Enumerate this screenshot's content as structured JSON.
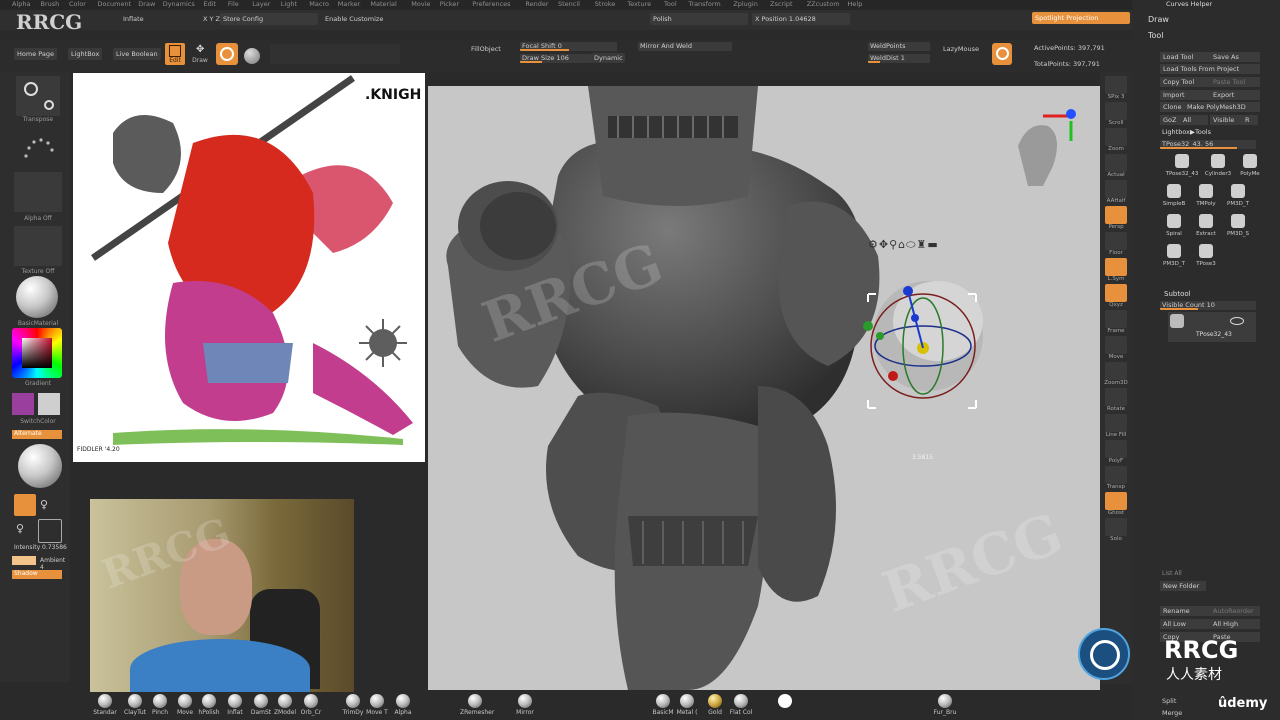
{
  "brand": {
    "watermark": "RRCG",
    "logo_text": "RRCG",
    "logo_sub": "人人素材",
    "udemy": "ûdemy"
  },
  "menu": [
    "Alpha",
    "Brush",
    "Color",
    "Document",
    "Draw",
    "Dynamics",
    "Edit",
    "File",
    "Layer",
    "Light",
    "Macro",
    "Marker",
    "Material",
    "Movie",
    "Picker",
    "Preferences",
    "Render",
    "Stencil",
    "Stroke",
    "Texture",
    "Tool",
    "Transform",
    "Zplugin",
    "Zscript",
    "ZZcustom",
    "Help"
  ],
  "top_row1": {
    "inflate": "Inflate",
    "xyz": "X Y Z",
    "store_config": "Store Config",
    "enable_customize": "Enable Customize",
    "polish": "Polish",
    "x_position": "X Position 1.04628",
    "spotlight": "Spotlight Projection"
  },
  "top_row2": {
    "home_page": "Home Page",
    "lightbox": "LightBox",
    "live_boolean": "Live Boolean",
    "edit": "Edit",
    "draw": "Draw",
    "fill_object": "FillObject",
    "focal_shift": "Focal Shift 0",
    "draw_size": "Draw Size 106",
    "dynamic": "Dynamic",
    "mirror_weld": "Mirror And Weld",
    "weld_points": "WeldPoints",
    "weld_dist": "WeldDist 1",
    "lazy_mouse": "LazyMouse",
    "active_points": "ActivePoints: 397,791",
    "total_points": "TotalPoints: 397,791"
  },
  "left_tray": {
    "transpose": "Transpose",
    "alpha_off": "Alpha Off",
    "texture_off": "Texture Off",
    "basic_material": "BasicMaterial",
    "gradient": "Gradient",
    "switch_color": "SwitchColor",
    "alternate": "Alternate",
    "intensity": "Intensity 0.73586",
    "ambient": "Ambient 4",
    "shadow": "Shadow"
  },
  "reference": {
    "title": ".KNIGH",
    "signature": "FIDDLER '4.20"
  },
  "viewport": {
    "readout": "3.5815"
  },
  "right_tools": [
    "SPix 3",
    "Scroll",
    "Zoom",
    "Actual",
    "AAHalf",
    "Persp",
    "Floor",
    "L.Sym",
    "Qxyz",
    "Frame",
    "Move",
    "Zoom3D",
    "Rotate",
    "Line Fill",
    "PolyF",
    "Transp",
    "Ghost",
    "Solo"
  ],
  "right_panel": {
    "curves_helper": "Curves Helper",
    "draw": "Draw",
    "tool": "Tool",
    "load_tool": "Load Tool",
    "save_as": "Save As",
    "load_from_project": "Load Tools From Project",
    "copy_tool": "Copy Tool",
    "paste_tool": "Paste Tool",
    "import": "Import",
    "export": "Export",
    "clone": "Clone",
    "make_polymesh": "Make PolyMesh3D",
    "goz": "GoZ",
    "all": "All",
    "visible": "Visible",
    "r": "R",
    "lightbox_tools": "Lightbox▶Tools",
    "tpose_slider": "TPose32_43. 56",
    "thumbs": [
      "TPose32_43",
      "Cylinder3",
      "PolyMe",
      "SimpleB",
      "TMPoly",
      "PM3D_T",
      "Spiral",
      "Extract",
      "PM3D_S",
      "PM3D_T",
      "TPose3"
    ],
    "subtool": "Subtool",
    "visible_count": "Visible Count 10",
    "subtool_item": "TPose32_43",
    "list_all": "List All",
    "new_folder": "New Folder",
    "rename": "Rename",
    "auto_reorder": "AutoReorder",
    "all_low": "All Low",
    "all_high": "All High",
    "copy": "Copy",
    "paste": "Paste",
    "split": "Split",
    "merge": "Merge"
  },
  "bottom_brushes": [
    "Standar",
    "ClayTut",
    "Pinch",
    "Move",
    "hPolish",
    "Inflat",
    "DamSt",
    "ZModel",
    "Orb_Cr",
    "TrimDy",
    "Move T",
    "Alpha",
    "ZRemesher",
    "Mirror",
    "BasicM",
    "Metal (",
    "Gold",
    "Flat Col",
    "",
    "Fur_Bru"
  ]
}
